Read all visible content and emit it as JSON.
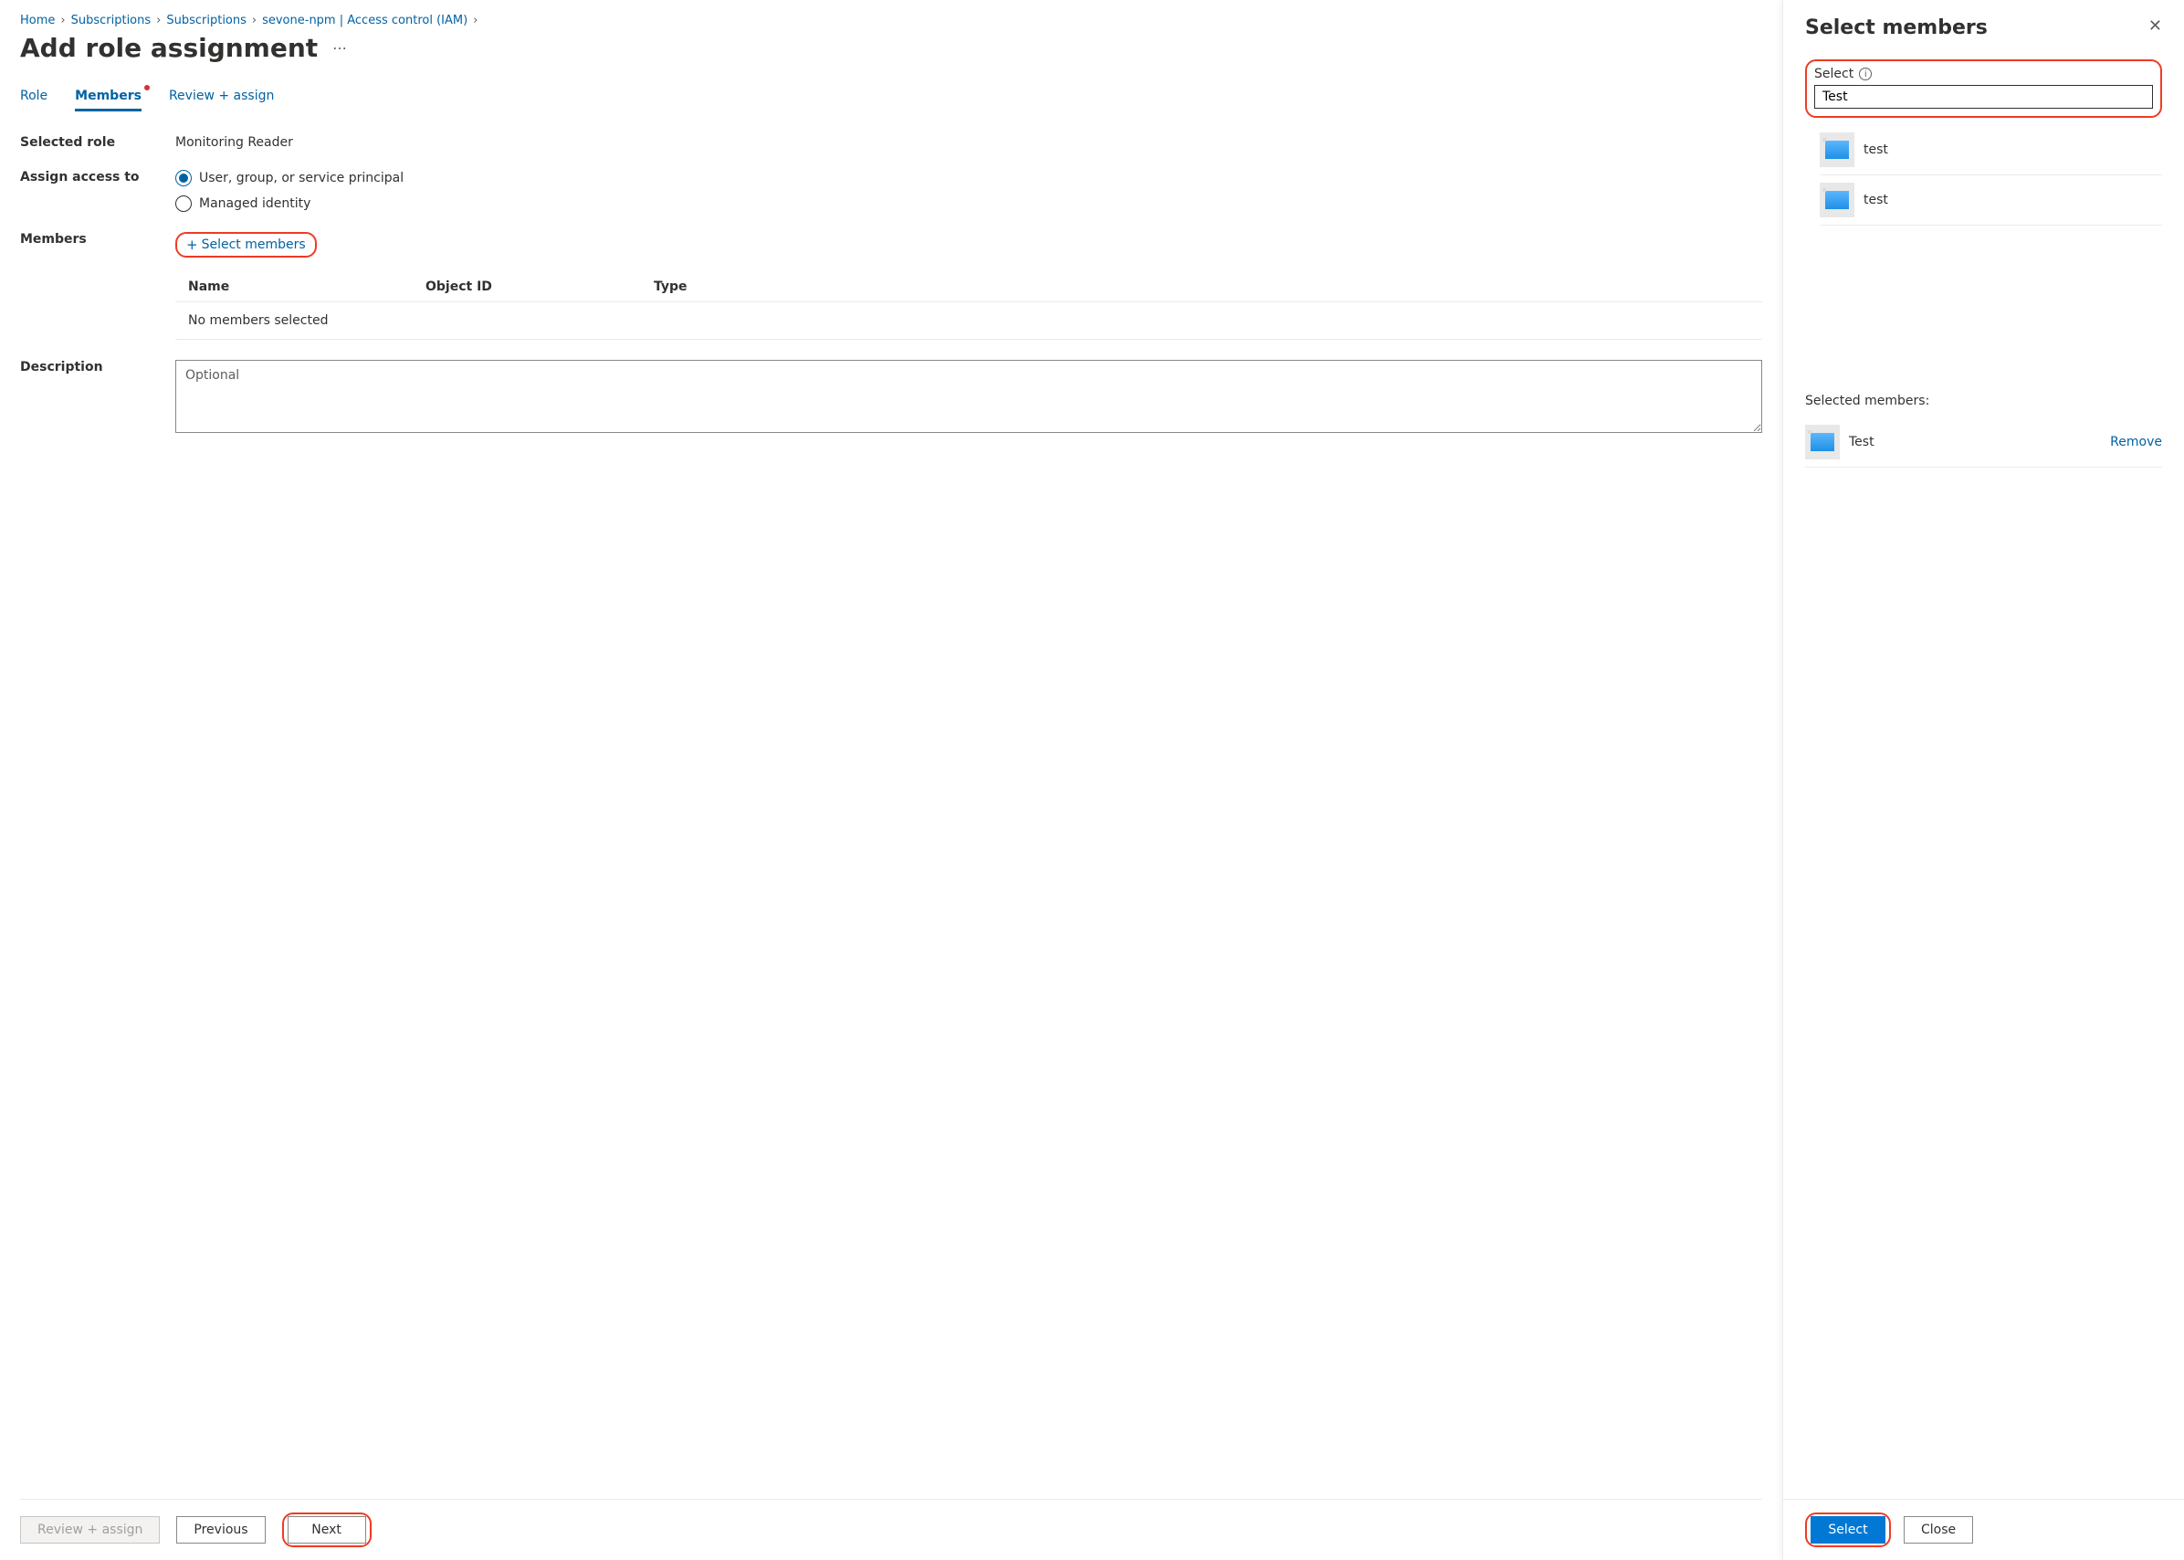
{
  "breadcrumb": {
    "items": [
      {
        "label": "Home"
      },
      {
        "label": "Subscriptions"
      },
      {
        "label": "Subscriptions"
      },
      {
        "label": "sevone-npm | Access control (IAM)"
      }
    ]
  },
  "page": {
    "title": "Add role assignment",
    "tabs": {
      "role": "Role",
      "members": "Members",
      "review": "Review + assign"
    },
    "form": {
      "selected_role_label": "Selected role",
      "selected_role_value": "Monitoring Reader",
      "assign_access_label": "Assign access to",
      "radio_user": "User, group, or service principal",
      "radio_managed": "Managed identity",
      "members_label": "Members",
      "select_members_link": "Select members",
      "table": {
        "col_name": "Name",
        "col_object": "Object ID",
        "col_type": "Type",
        "empty": "No members selected"
      },
      "description_label": "Description",
      "description_placeholder": "Optional"
    },
    "footer": {
      "review": "Review + assign",
      "previous": "Previous",
      "next": "Next"
    }
  },
  "panel": {
    "title": "Select members",
    "search": {
      "label": "Select",
      "value": "Test"
    },
    "results": [
      {
        "name": "test"
      },
      {
        "name": "test"
      }
    ],
    "selected_label": "Selected members:",
    "selected": [
      {
        "name": "Test"
      }
    ],
    "remove_label": "Remove",
    "footer": {
      "select": "Select",
      "close": "Close"
    }
  }
}
